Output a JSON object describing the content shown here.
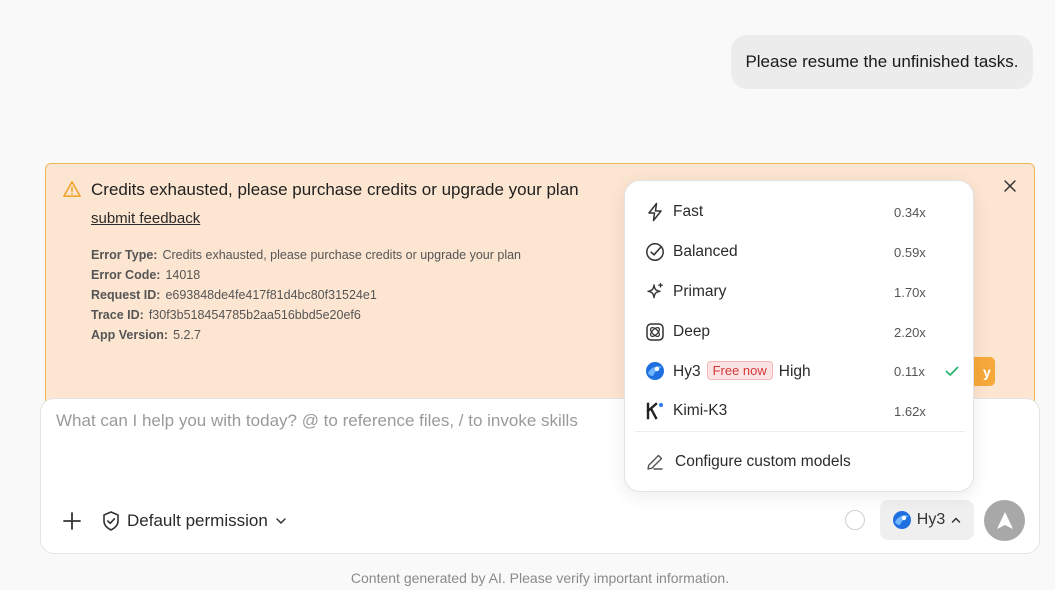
{
  "chat": {
    "user_message": "Please resume the unfinished tasks."
  },
  "alert": {
    "title": "Credits exhausted, please purchase credits or upgrade your plan",
    "feedback_link": "submit feedback",
    "details": [
      {
        "label": "Error Type:",
        "value": "Credits exhausted, please purchase credits or upgrade your plan"
      },
      {
        "label": "Error Code:",
        "value": "14018"
      },
      {
        "label": "Request ID:",
        "value": "e693848de4fe417f81d4bc80f31524e1"
      },
      {
        "label": "Trace ID:",
        "value": "f30f3b518454785b2aa516bbd5e20ef6"
      },
      {
        "label": "App Version:",
        "value": "5.2.7"
      }
    ],
    "partial_button_glyph": "y",
    "warning_color": "#f2a72e",
    "background_color": "#fce5d1"
  },
  "model_menu": {
    "items": [
      {
        "icon": "lightning-icon",
        "label": "Fast",
        "multiplier": "0.34x"
      },
      {
        "icon": "check-circle-icon",
        "label": "Balanced",
        "multiplier": "0.59x"
      },
      {
        "icon": "sparkle-icon",
        "label": "Primary",
        "multiplier": "1.70x"
      },
      {
        "icon": "deep-icon",
        "label": "Deep",
        "multiplier": "2.20x"
      },
      {
        "icon": "hy3-logo-icon",
        "label": "Hy3",
        "badge": "Free now",
        "suffix": "High",
        "multiplier": "0.11x",
        "selected": true
      },
      {
        "icon": "kimi-logo-icon",
        "label": "Kimi-K3",
        "multiplier": "1.62x"
      }
    ],
    "configure_label": "Configure custom models",
    "check_color": "#2bb673"
  },
  "composer": {
    "placeholder": "What can I help you with today? @ to reference files, / to invoke skills",
    "permission_label": "Default permission",
    "model_label": "Hy3"
  },
  "footer": {
    "note": "Content generated by AI. Please verify important information."
  }
}
